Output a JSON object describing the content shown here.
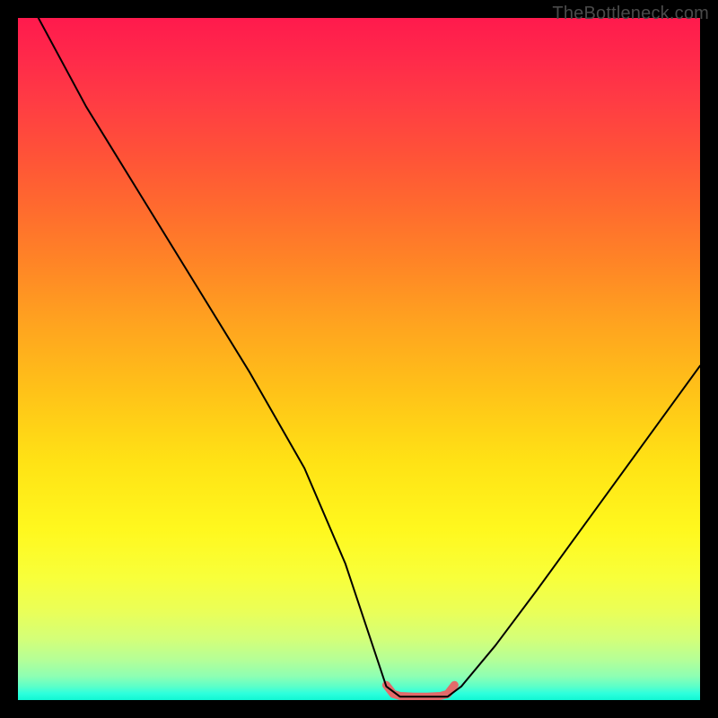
{
  "watermark": "TheBottleneck.com",
  "chart_data": {
    "type": "line",
    "title": "",
    "xlabel": "",
    "ylabel": "",
    "xlim": [
      0,
      100
    ],
    "ylim": [
      0,
      100
    ],
    "grid": false,
    "legend": false,
    "series": [
      {
        "name": "curve",
        "stroke": "#000000",
        "stroke_width": 2,
        "x": [
          3,
          10,
          18,
          26,
          34,
          42,
          48,
          52,
          54,
          56,
          58,
          61,
          63,
          65,
          70,
          76,
          84,
          92,
          100
        ],
        "y": [
          100,
          87,
          74,
          61,
          48,
          34,
          20,
          8,
          2,
          0.5,
          0.5,
          0.5,
          0.5,
          2,
          8,
          16,
          27,
          38,
          49
        ]
      },
      {
        "name": "valley-band",
        "stroke": "#e26a6a",
        "stroke_width": 9,
        "x": [
          54,
          55,
          56,
          58,
          60,
          62,
          63,
          64
        ],
        "y": [
          2.2,
          0.9,
          0.6,
          0.5,
          0.5,
          0.6,
          0.9,
          2.2
        ]
      }
    ],
    "colors": {
      "gradient_top": "#ff1a4d",
      "gradient_mid": "#ffe215",
      "gradient_bottom": "#11f7d4",
      "curve": "#000000",
      "valley_band": "#e26a6a",
      "background": "#000000",
      "watermark": "#4a4a4a"
    }
  }
}
